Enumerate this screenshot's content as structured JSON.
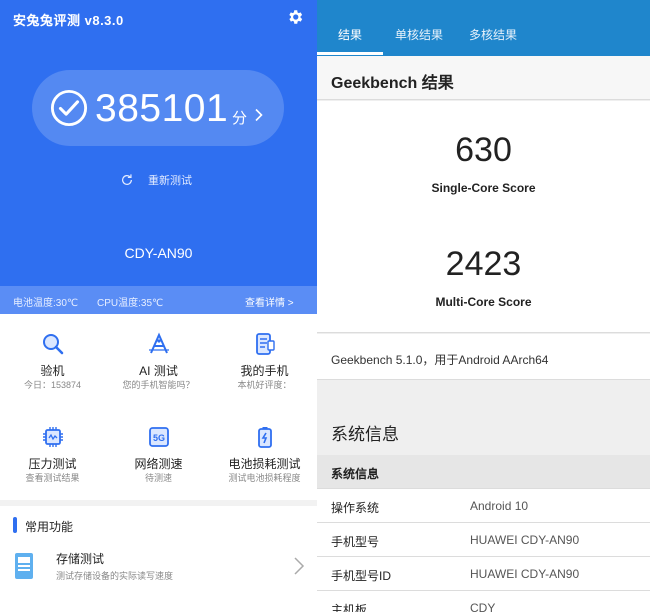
{
  "left": {
    "app_title": "安兔兔评测 v8.3.0",
    "score": "385101",
    "score_unit": "分",
    "retest_label": "重新测试",
    "device_name": "CDY-AN90",
    "battery_temp": "电池温度:30℃",
    "cpu_temp": "CPU温度:35℃",
    "view_detail": "查看详情 >",
    "grid": [
      {
        "label": "验机",
        "sub": "今日：153874",
        "icon": "magnifier-icon"
      },
      {
        "label": "AI 测试",
        "sub": "您的手机智能吗？",
        "icon": "ai-icon"
      },
      {
        "label": "我的手机",
        "sub": "本机好评度：",
        "icon": "phone-info-icon"
      },
      {
        "label": "压力测试",
        "sub": "查看测试结果",
        "icon": "chip-icon"
      },
      {
        "label": "网络测速",
        "sub": "待测速",
        "icon": "5g-icon"
      },
      {
        "label": "电池损耗测试",
        "sub": "测试电池损耗程度",
        "icon": "battery-icon"
      }
    ],
    "functions_title": "常用功能",
    "storage_label": "存储测试",
    "storage_sub": "测试存储设备的实际读写速度",
    "accent": "#2f6ff0"
  },
  "right": {
    "tabs": [
      "结果",
      "单核结果",
      "多核结果"
    ],
    "header": "Geekbench 结果",
    "single_score": "630",
    "single_label": "Single-Core Score",
    "multi_score": "2423",
    "multi_label": "Multi-Core Score",
    "version_line": "Geekbench 5.1.0，用于Android AArch64",
    "sys_info_title": "系统信息",
    "table_header": "系统信息",
    "rows": [
      {
        "k": "操作系统",
        "v": "Android 10"
      },
      {
        "k": "手机型号",
        "v": "HUAWEI CDY-AN90"
      },
      {
        "k": "手机型号ID",
        "v": "HUAWEI CDY-AN90"
      },
      {
        "k": "主机板",
        "v": "CDY"
      }
    ],
    "accent": "#1f86cc"
  }
}
